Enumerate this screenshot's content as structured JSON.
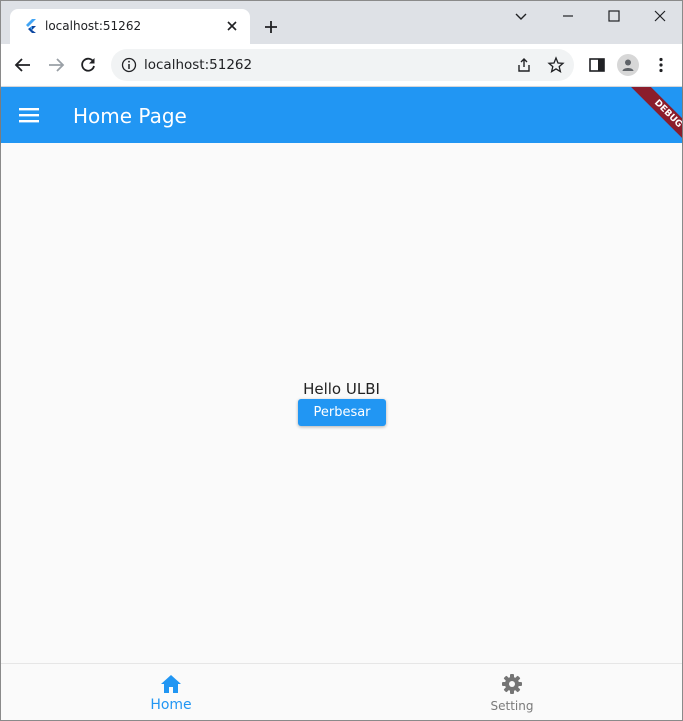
{
  "browser": {
    "tab_title": "localhost:51262",
    "url": "localhost:51262"
  },
  "colors": {
    "app_bar": "#2196f3",
    "button": "#2196f3",
    "active_nav": "#2196f3",
    "inactive_nav": "#7b7b7b",
    "debug_banner": "#8b1d2c"
  },
  "app_bar": {
    "title": "Home Page",
    "menu_icon": "hamburger-menu-icon",
    "debug_label": "DEBUG"
  },
  "body": {
    "greeting": "Hello ULBI",
    "button_label": "Perbesar"
  },
  "bottom_nav": {
    "items": [
      {
        "label": "Home",
        "icon": "home-icon",
        "active": true
      },
      {
        "label": "Setting",
        "icon": "gear-icon",
        "active": false
      }
    ]
  }
}
